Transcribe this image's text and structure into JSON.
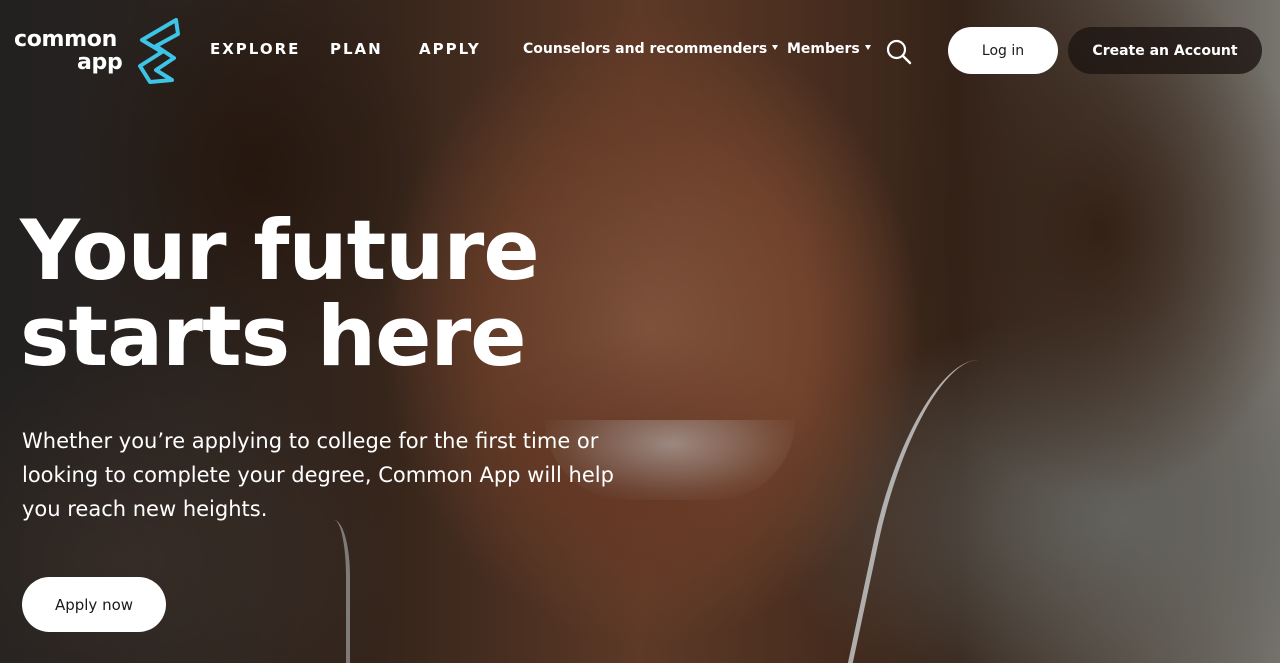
{
  "brand": {
    "logo_line1": "common",
    "logo_line2": "app",
    "accent_color": "#3dc5e8"
  },
  "nav": {
    "explore": "EXPLORE",
    "plan": "PLAN",
    "apply": "APPLY",
    "counselors": "Counselors and recommenders",
    "members": "Members",
    "search_icon": "search-icon"
  },
  "auth": {
    "login": "Log in",
    "create_account": "Create an Account"
  },
  "hero": {
    "title_line1": "Your future",
    "title_line2": "starts here",
    "subtitle": "Whether you’re applying to college for the first time or looking to complete your degree, Common App will help you reach new heights.",
    "cta": "Apply now"
  }
}
